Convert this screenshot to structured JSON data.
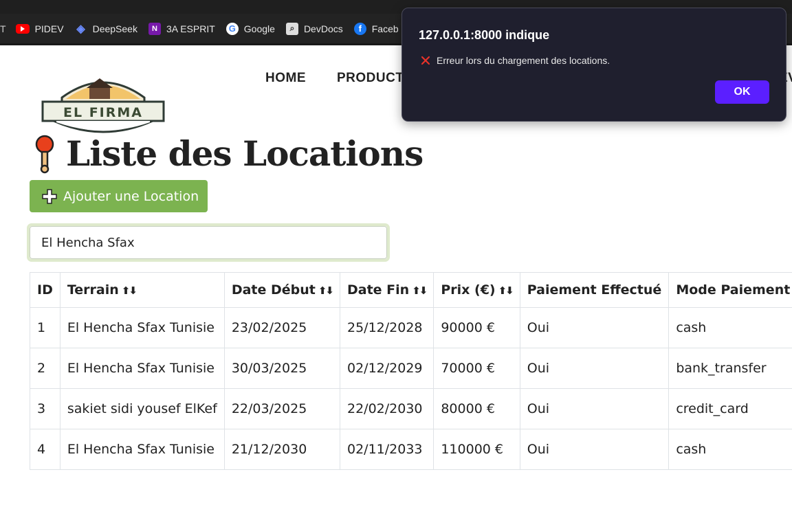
{
  "browser": {
    "bookmarks": [
      {
        "label": "PIDEV",
        "icon": "youtube-icon"
      },
      {
        "label": "DeepSeek",
        "icon": "deepseek-icon"
      },
      {
        "label": "3A ESPRIT",
        "icon": "onenote-icon"
      },
      {
        "label": "Google",
        "icon": "google-icon"
      },
      {
        "label": "DevDocs",
        "icon": "devdocs-icon"
      },
      {
        "label": "Faceb",
        "icon": "facebook-icon"
      }
    ]
  },
  "site": {
    "logo_text": "EL FIRMA",
    "nav": {
      "home": "HOME",
      "products": "PRODUCT",
      "cut_off": "EV"
    }
  },
  "page": {
    "title": "Liste des Locations",
    "add_button": "Ajouter une Location",
    "search_value": "El Hencha Sfax"
  },
  "table": {
    "headers": {
      "id": "ID",
      "terrain": "Terrain",
      "date_debut": "Date Début",
      "date_fin": "Date Fin",
      "prix": "Prix (€)",
      "paiement": "Paiement Effectué",
      "mode": "Mode Paiement"
    },
    "sort_glyph": "⬆⬇",
    "rows": [
      {
        "id": "1",
        "terrain": "El Hencha Sfax Tunisie",
        "date_debut": "23/02/2025",
        "date_fin": "25/12/2028",
        "prix": "90000 €",
        "paiement": "Oui",
        "mode": "cash"
      },
      {
        "id": "2",
        "terrain": "El Hencha Sfax Tunisie",
        "date_debut": "30/03/2025",
        "date_fin": "02/12/2029",
        "prix": "70000 €",
        "paiement": "Oui",
        "mode": "bank_transfer"
      },
      {
        "id": "3",
        "terrain": "sakiet sidi yousef ElKef",
        "date_debut": "22/03/2025",
        "date_fin": "22/02/2030",
        "prix": "80000 €",
        "paiement": "Oui",
        "mode": "credit_card"
      },
      {
        "id": "4",
        "terrain": "El Hencha Sfax Tunisie",
        "date_debut": "21/12/2030",
        "date_fin": "02/11/2033",
        "prix": "110000 €",
        "paiement": "Oui",
        "mode": "cash"
      }
    ]
  },
  "dialog": {
    "title": "127.0.0.1:8000 indique",
    "message": "Erreur lors du chargement des locations.",
    "ok_label": "OK"
  },
  "colors": {
    "add_button": "#7cb350",
    "ok_button": "#5b1fff",
    "dialog_bg": "#1f1f2e"
  }
}
